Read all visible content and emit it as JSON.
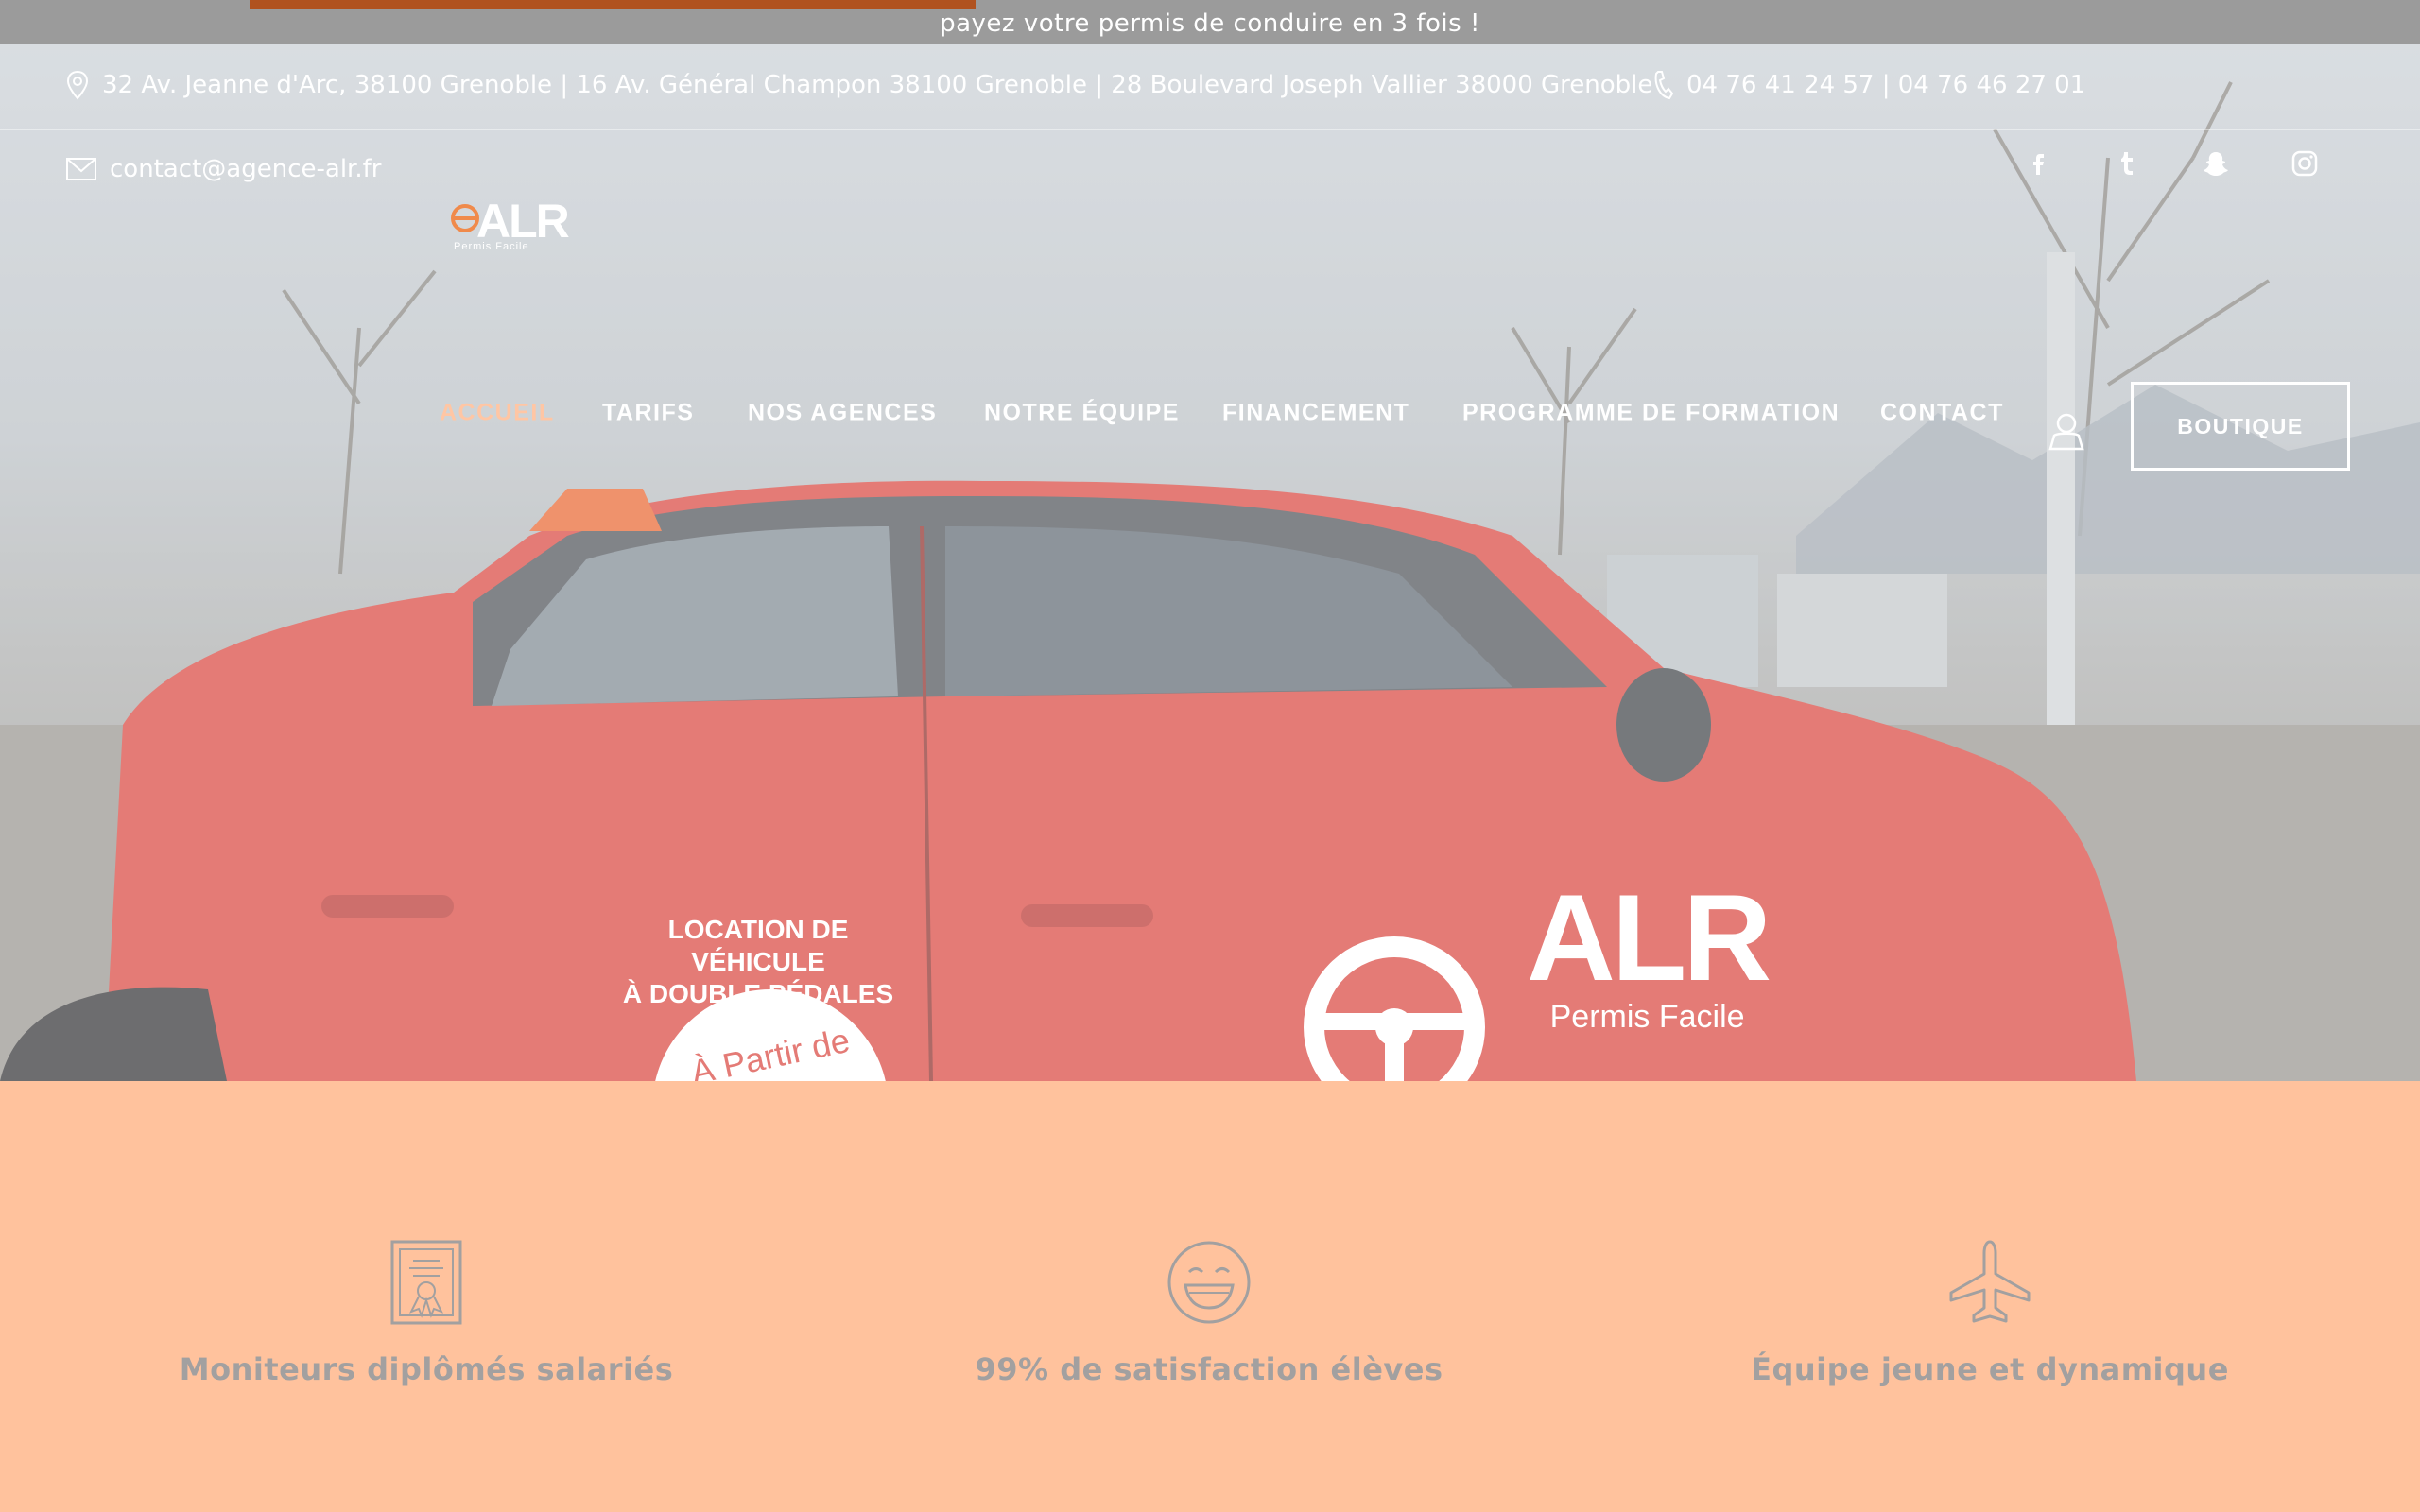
{
  "promo": {
    "text": "payez votre permis de conduire en 3 fois !",
    "progress_percent": 30
  },
  "header": {
    "address": "32 Av. Jeanne d'Arc, 38100 Grenoble | 16 Av. Général Champon 38100 Grenoble | 28 Boulevard Joseph Vallier 38000 Grenoble",
    "phone": "04 76 41 24 57 | 04 76 46 27 01",
    "email": "contact@agence-alr.fr",
    "socials": [
      "facebook-icon",
      "tumblr-icon",
      "snapchat-icon",
      "instagram-icon"
    ]
  },
  "logo": {
    "mark": "ALR",
    "tagline": "Permis Facile"
  },
  "nav": {
    "items": [
      "ACCUEIL",
      "TARIFS",
      "NOS AGENCES",
      "NOTRE ÉQUIPE",
      "FINANCEMENT",
      "PROGRAMME DE FORMATION",
      "CONTACT"
    ],
    "active": "ACCUEIL",
    "boutique": "BOUTIQUE"
  },
  "hero": {
    "car_text_line1": "LOCATION DE VÉHICULE",
    "car_text_line2": "À DOUBLE PÉDALES",
    "car_badge": "À Partir de",
    "car_brand": "ALR",
    "car_tagline": "Permis Facile"
  },
  "features": [
    {
      "icon": "certificate-icon",
      "label": "Moniteurs diplômés salariés"
    },
    {
      "icon": "smiley-icon",
      "label": "99% de satisfaction élèves"
    },
    {
      "icon": "plane-icon",
      "label": "Équipe jeune et dynamique"
    }
  ],
  "colors": {
    "accent": "#ffc29d",
    "promo_bar": "#9b9b9b",
    "progress": "#b0521f",
    "car_red": "#d9423b",
    "feature_text": "#a2a0a0"
  }
}
